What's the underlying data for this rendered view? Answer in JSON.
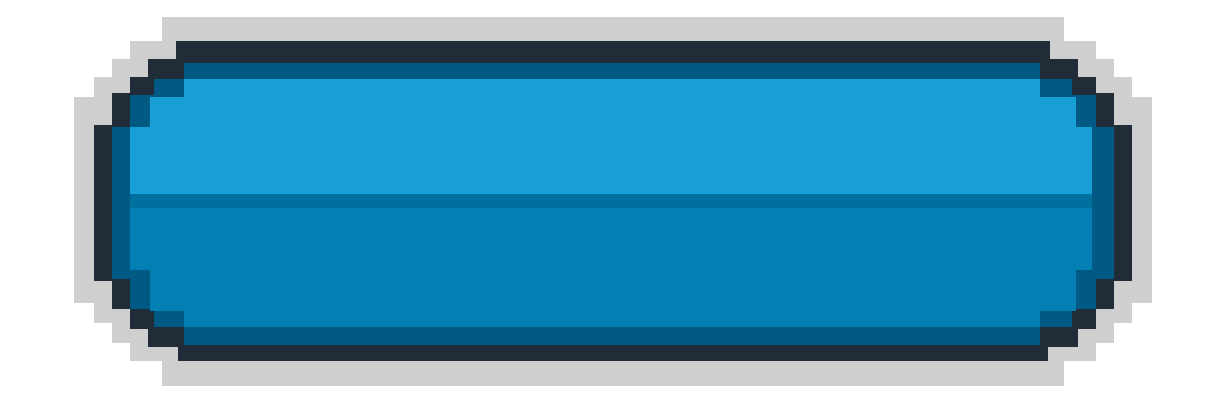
{
  "button": {
    "label": "",
    "colors": {
      "outer_shadow": "#cfcfcf",
      "outline": "#202d39",
      "dark_edge": "#005a84",
      "top_face": "#179fd6",
      "bottom_face": "#0280b3",
      "mid_seam": "#00709f"
    }
  }
}
